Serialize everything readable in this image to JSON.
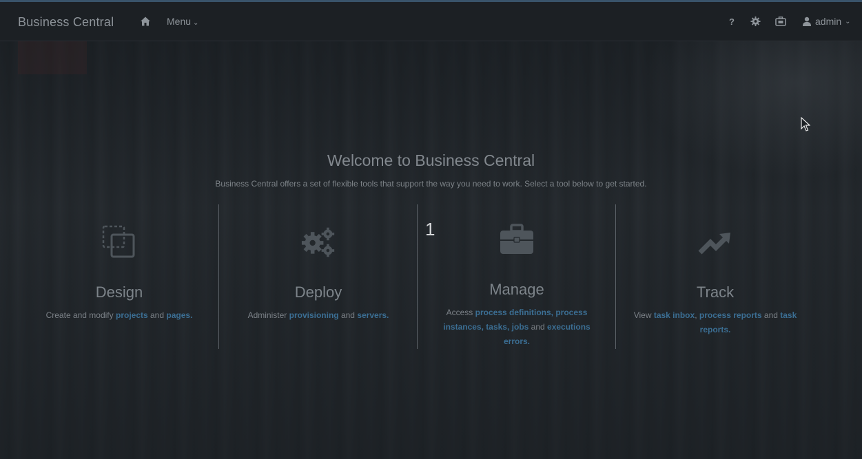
{
  "navbar": {
    "brand": "Business Central",
    "menu_label": "Menu",
    "help_label": "?",
    "user_label": "admin"
  },
  "welcome": {
    "title": "Welcome to Business Central",
    "subtitle": "Business Central offers a set of flexible tools that support the way you need to work. Select a tool below to get started."
  },
  "tiles": {
    "design": {
      "name": "Design",
      "desc_prefix": "Create and modify ",
      "link1": "projects",
      "mid": " and ",
      "link2": "pages",
      "end": "."
    },
    "deploy": {
      "name": "Deploy",
      "desc_prefix": "Administer ",
      "link1": "provisioning",
      "mid": " and ",
      "link2": "servers",
      "end": "."
    },
    "manage": {
      "name": "Manage",
      "desc_prefix": "Access ",
      "link1": "process definitions",
      "sep1": ", ",
      "link2": "process instances",
      "sep2": ", ",
      "link3": "tasks",
      "sep3": ", ",
      "link4": "jobs",
      "mid": " and ",
      "link5": "executions errors",
      "end": "."
    },
    "track": {
      "name": "Track",
      "desc_prefix": "View ",
      "link1": "task inbox",
      "sep1": ", ",
      "link2": "process reports",
      "mid": " and ",
      "link3": "task reports",
      "end": "."
    }
  },
  "step_number": "1",
  "colors": {
    "accent_link": "#3b6e93",
    "navbar_bg": "#1c2024",
    "top_line": "#39536a"
  },
  "icons": [
    "home-icon",
    "chevron-down-icon",
    "help-icon",
    "gear-icon",
    "briefcase-icon",
    "user-icon",
    "copy-icon",
    "gears-icon",
    "trend-up-icon",
    "mouse-cursor-icon"
  ]
}
